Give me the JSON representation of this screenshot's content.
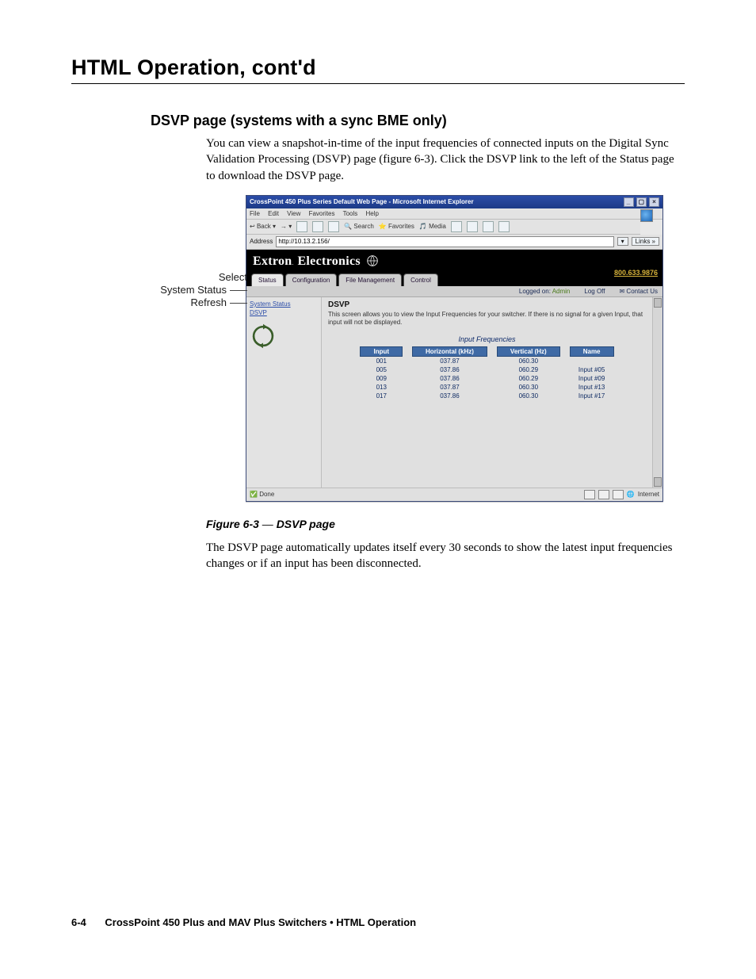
{
  "h1": "HTML Operation, cont'd",
  "h2": "DSVP page (systems with a sync BME only)",
  "para1": "You can view a snapshot-in-time of the input frequencies of connected inputs on the Digital Sync Validation Processing (DSVP) page (figure 6-3).  Click the DSVP link to the left of the Status page to download the DSVP page.",
  "callouts": {
    "a": "Select",
    "b": "System Status",
    "c": "Refresh"
  },
  "figcap_bold": "Figure 6-3",
  "figcap_dash": " — ",
  "figcap_title": "DSVP page",
  "para2": "The DSVP page automatically updates itself every 30 seconds to show the latest input frequencies changes or if an input has been disconnected.",
  "footer_pg": "6-4",
  "footer_txt": "CrossPoint 450 Plus and MAV Plus Switchers • HTML Operation",
  "ie": {
    "title": "CrossPoint 450 Plus Series Default Web Page - Microsoft Internet Explorer",
    "menu": {
      "file": "File",
      "edit": "Edit",
      "view": "View",
      "favorites": "Favorites",
      "tools": "Tools",
      "help": "Help"
    },
    "toolbar": {
      "back": "Back",
      "search": "Search",
      "favorites": "Favorites",
      "media": "Media"
    },
    "addr_label": "Address",
    "addr_value": "http://10.13.2.156/",
    "links": "Links",
    "status_done": "Done",
    "status_zone": "Internet"
  },
  "page": {
    "brand": "Extron",
    "brand2": "Electronics",
    "phone": "800.633.9876",
    "tabs": {
      "status": "Status",
      "config": "Configuration",
      "filemgmt": "File Management",
      "control": "Control"
    },
    "sub": {
      "logged": "Logged on:",
      "logged_as": "Admin",
      "logoff": "Log Off",
      "contact": "Contact Us"
    },
    "sidebar": {
      "system_status": "System Status",
      "dsvp": "DSVP"
    },
    "main": {
      "heading": "DSVP",
      "desc": "This screen allows you to view the Input Frequencies for your switcher. If there is no signal for a given Input, that input will not be displayed.",
      "table_title": "Input Frequencies",
      "cols": {
        "input": "Input",
        "hkhz": "Horizontal (kHz)",
        "vhz": "Vertical (Hz)",
        "name": "Name"
      },
      "rows": [
        {
          "input": "001",
          "h": "037.87",
          "v": "060.30",
          "name": ""
        },
        {
          "input": "005",
          "h": "037.86",
          "v": "060.29",
          "name": "Input #05"
        },
        {
          "input": "009",
          "h": "037.86",
          "v": "060.29",
          "name": "Input #09"
        },
        {
          "input": "013",
          "h": "037.87",
          "v": "060.30",
          "name": "Input #13"
        },
        {
          "input": "017",
          "h": "037.86",
          "v": "060.30",
          "name": "Input #17"
        }
      ]
    }
  }
}
